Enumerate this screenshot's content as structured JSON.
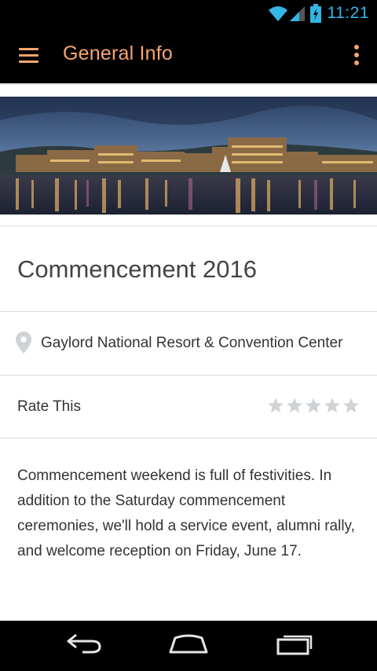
{
  "status_bar": {
    "time": "11:21"
  },
  "header": {
    "title": "General Info"
  },
  "event": {
    "title": "Commencement 2016",
    "location": "Gaylord National Resort & Convention Center",
    "rate_label": "Rate This",
    "rating": 0,
    "rating_max": 5,
    "description": "Commencement weekend is full of festivities. In addition to the Saturday commencement ceremonies, we'll hold a service event, alumni rally, and welcome reception on Friday, June 17."
  },
  "colors": {
    "accent": "#f7a66e",
    "status_icons": "#33b5e5",
    "star_empty": "#cfd3d6"
  },
  "icons": {
    "menu": "hamburger-icon",
    "overflow": "overflow-menu-icon",
    "location": "map-pin-icon",
    "star": "star-icon",
    "back": "back-icon",
    "home": "home-icon",
    "recents": "recent-apps-icon"
  }
}
